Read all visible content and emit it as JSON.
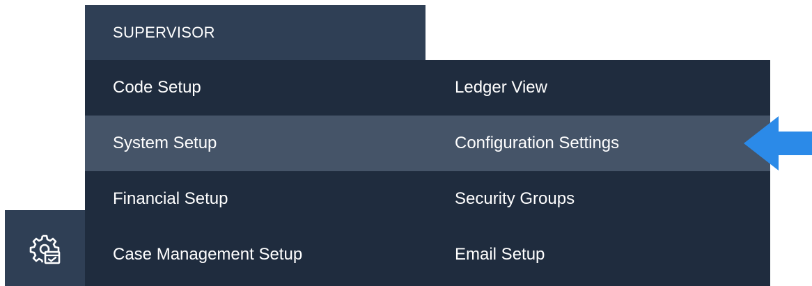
{
  "menu": {
    "header": "SUPERVISOR",
    "rows": [
      {
        "left": "Code Setup",
        "right": "Ledger View",
        "highlighted": false
      },
      {
        "left": "System Setup",
        "right": "Configuration Settings",
        "highlighted": true
      },
      {
        "left": "Financial Setup",
        "right": "Security Groups",
        "highlighted": false
      },
      {
        "left": "Case Management Setup",
        "right": "Email Setup",
        "highlighted": false
      }
    ]
  },
  "icons": {
    "supervisor_tab": "settings-gear-checklist-icon",
    "pointer": "arrow-left-icon"
  },
  "colors": {
    "header_bg": "#2f3f55",
    "panel_bg": "#1f2c3e",
    "highlight_bg": "#455468",
    "text": "#ffffff",
    "arrow": "#2b8ae8"
  }
}
